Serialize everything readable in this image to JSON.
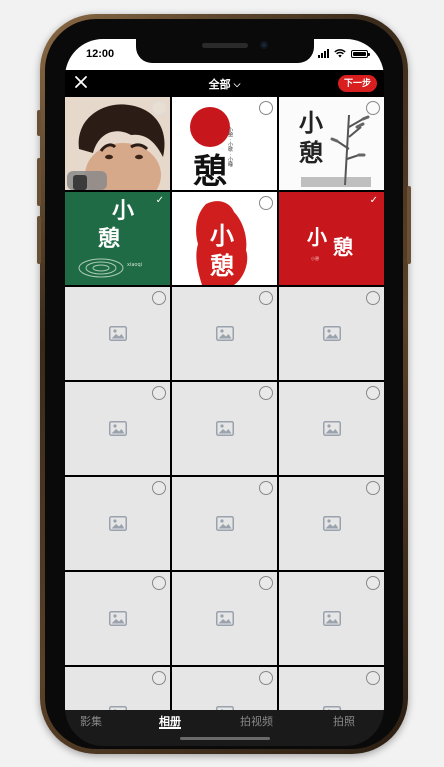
{
  "status": {
    "time": "12:00"
  },
  "topnav": {
    "album_label": "全部",
    "chevron": "⌵",
    "next_label": "下一步"
  },
  "photos": [
    {
      "kind": "portrait",
      "selected": false,
      "selector_style": "light"
    },
    {
      "kind": "logo",
      "text1": "小",
      "text2": "憩",
      "side_text": "小憩 · 小歇 · 小睡",
      "selected": false,
      "selector_style": "dark"
    },
    {
      "kind": "logo",
      "text1": "小",
      "text2": "憩",
      "selected": false,
      "selector_style": "dark"
    },
    {
      "kind": "logo",
      "text1": "小",
      "text2": "憩",
      "caption": "xiaoqi",
      "selected": true,
      "selector_style": "light"
    },
    {
      "kind": "logo",
      "text1": "小",
      "text2": "憩",
      "selected": false,
      "selector_style": "dark"
    },
    {
      "kind": "logo",
      "text1": "小",
      "text2": "憩",
      "stamp": "小憩",
      "selected": true,
      "selector_style": "light"
    }
  ],
  "placeholder_count": 15,
  "tabs": [
    "影集",
    "相册",
    "拍视频",
    "拍照"
  ],
  "active_tab": "相册",
  "colors": {
    "accent": "#d81e1e",
    "green_tile": "#1f6b45",
    "red_tile": "#c8161d"
  }
}
